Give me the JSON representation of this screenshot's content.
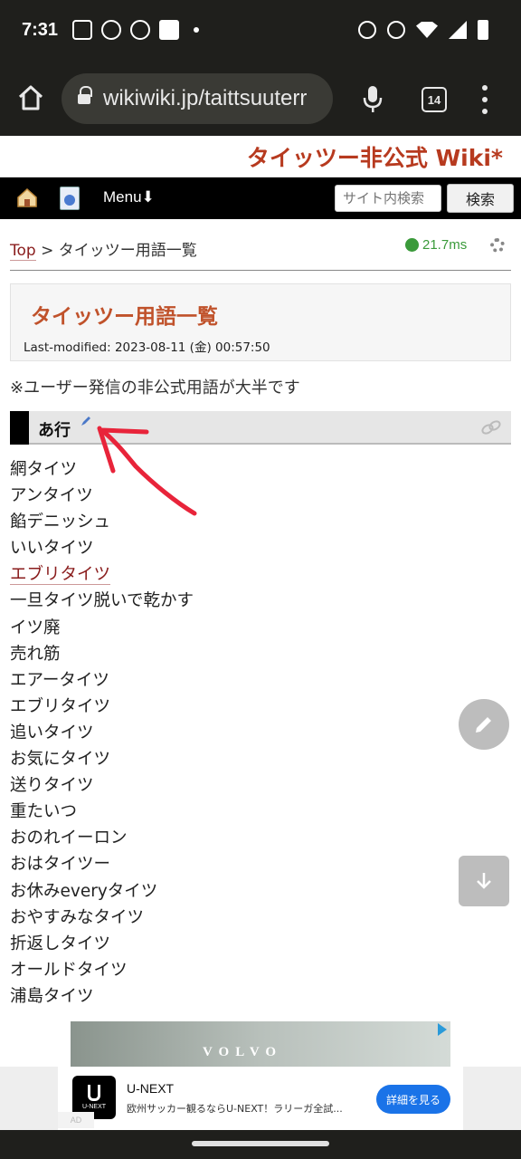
{
  "status_bar": {
    "time": "7:31",
    "icons_left": [
      "mail-icon",
      "pinwheel-icon",
      "cat-icon",
      "app-icon",
      "dot-icon"
    ],
    "icons_right": [
      "mute-icon",
      "dnd-icon",
      "wifi-icon",
      "signal-icon",
      "battery-icon"
    ]
  },
  "browser": {
    "url": "wikiwiki.jp/taittsuuterr",
    "tab_count": "14"
  },
  "site": {
    "title": "タイッツー非公式 Wiki*"
  },
  "nav": {
    "menu_label": "Menu⬇",
    "search_placeholder": "サイト内検索",
    "search_button": "検索"
  },
  "breadcrumb": {
    "top": "Top",
    "separator": " > ",
    "current": "タイッツー用語一覧"
  },
  "load_time": "21.7ms",
  "page": {
    "title": "タイッツー用語一覧",
    "last_modified": "Last-modified: 2023-08-11 (金) 00:57:50",
    "note": "※ユーザー発信の非公式用語が大半です",
    "section_title": "あ行"
  },
  "terms": [
    {
      "text": "網タイツ",
      "link": false
    },
    {
      "text": "アンタイツ",
      "link": false
    },
    {
      "text": "餡デニッシュ",
      "link": false
    },
    {
      "text": "いいタイツ",
      "link": false
    },
    {
      "text": "エブリタイツ",
      "link": true
    },
    {
      "text": "一旦タイツ脱いで乾かす",
      "link": false
    },
    {
      "text": "イツ廃",
      "link": false
    },
    {
      "text": "売れ筋",
      "link": false
    },
    {
      "text": "エアータイツ",
      "link": false
    },
    {
      "text": "エブリタイツ",
      "link": false
    },
    {
      "text": "追いタイツ",
      "link": false
    },
    {
      "text": "お気にタイツ",
      "link": false
    },
    {
      "text": "送りタイツ",
      "link": false
    },
    {
      "text": "重たいつ",
      "link": false
    },
    {
      "text": "おのれイーロン",
      "link": false
    },
    {
      "text": "おはタイツー",
      "link": false
    },
    {
      "text": "お休みeveryタイツ",
      "link": false
    },
    {
      "text": "おやすみなタイツ",
      "link": false
    },
    {
      "text": "折返しタイツ",
      "link": false
    },
    {
      "text": "オールドタイツ",
      "link": false
    },
    {
      "text": "浦島タイツ",
      "link": false
    }
  ],
  "ad": {
    "image_brand": "VOLVO",
    "logo_text": "U-NEXT",
    "title": "U-NEXT",
    "description": "欧州サッカー観るならU-NEXT！ラリーガ全試...",
    "cta": "詳細を見る",
    "label": "AD"
  },
  "colors": {
    "site_title": "#b73a1f",
    "page_title": "#c0522b",
    "link": "#8a1d1d",
    "load_time": "#3a9a3a",
    "annotation": "#e8243a"
  }
}
